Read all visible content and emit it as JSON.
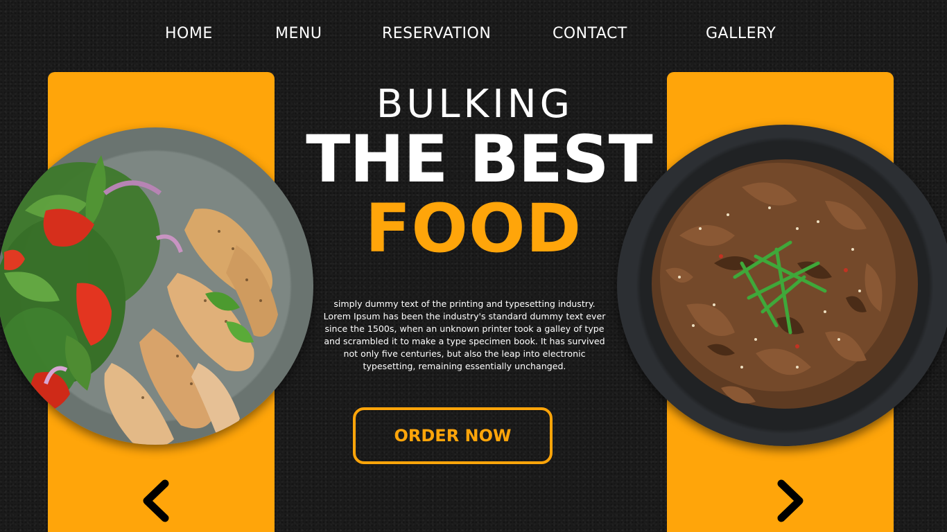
{
  "nav": {
    "items": [
      "HOME",
      "MENU",
      "RESERVATION",
      "CONTACT",
      "GALLERY"
    ]
  },
  "hero": {
    "kicker": "BULKING",
    "headline": "THE BEST",
    "highlight": "FOOD",
    "description": "simply dummy text of the printing and typesetting industry. Lorem Ipsum has been the industry's standard dummy text ever since the 1500s, when an unknown printer took a galley of type and scrambled it to make a type specimen book. It has survived not only five centuries, but also the leap into electronic typesetting, remaining essentially unchanged.",
    "cta_label": "ORDER NOW"
  },
  "images": {
    "left_dish": "chicken-salad-plate",
    "right_dish": "beef-bulgogi-plate"
  },
  "icons": {
    "prev": "chevron-left-icon",
    "next": "chevron-right-icon"
  },
  "colors": {
    "accent": "#ffa50a",
    "background": "#1b1b1b",
    "text": "#ffffff"
  }
}
